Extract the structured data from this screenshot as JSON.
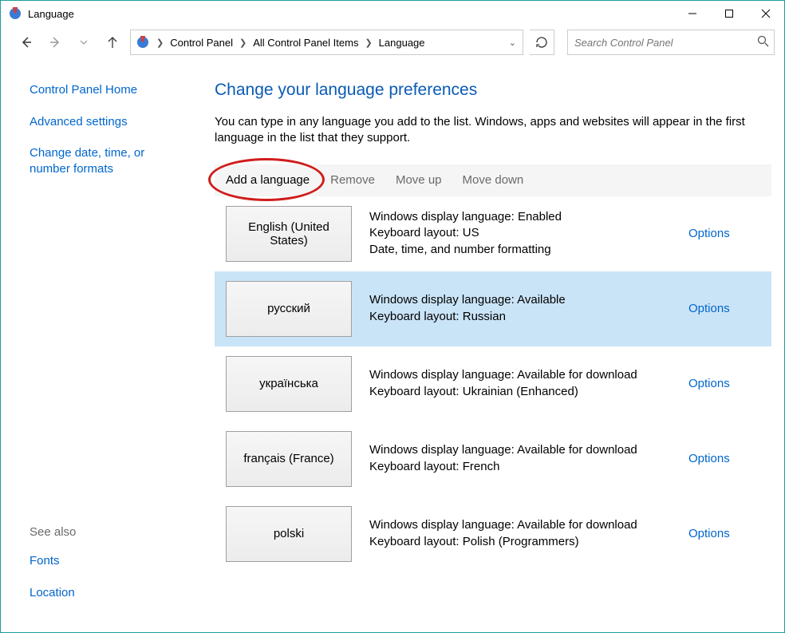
{
  "window": {
    "title": "Language"
  },
  "breadcrumb": {
    "items": [
      "Control Panel",
      "All Control Panel Items",
      "Language"
    ]
  },
  "search": {
    "placeholder": "Search Control Panel"
  },
  "sidebar": {
    "home": "Control Panel Home",
    "links": [
      "Advanced settings",
      "Change date, time, or number formats"
    ],
    "see_also_label": "See also",
    "see_also": [
      "Fonts",
      "Location"
    ]
  },
  "page": {
    "title": "Change your language preferences",
    "description": "You can type in any language you add to the list. Windows, apps and websites will appear in the first language in the list that they support."
  },
  "toolbar": {
    "add": "Add a language",
    "remove": "Remove",
    "move_up": "Move up",
    "move_down": "Move down"
  },
  "options_label": "Options",
  "languages": [
    {
      "name": "English (United States)",
      "line1": "Windows display language: Enabled",
      "line2": "Keyboard layout: US",
      "line3": "Date, time, and number formatting",
      "selected": false
    },
    {
      "name": "русский",
      "line1": "Windows display language: Available",
      "line2": "Keyboard layout: Russian",
      "line3": "",
      "selected": true
    },
    {
      "name": "українська",
      "line1": "Windows display language: Available for download",
      "line2": "Keyboard layout: Ukrainian (Enhanced)",
      "line3": "",
      "selected": false
    },
    {
      "name": "français (France)",
      "line1": "Windows display language: Available for download",
      "line2": "Keyboard layout: French",
      "line3": "",
      "selected": false
    },
    {
      "name": "polski",
      "line1": "Windows display language: Available for download",
      "line2": "Keyboard layout: Polish (Programmers)",
      "line3": "",
      "selected": false
    }
  ]
}
